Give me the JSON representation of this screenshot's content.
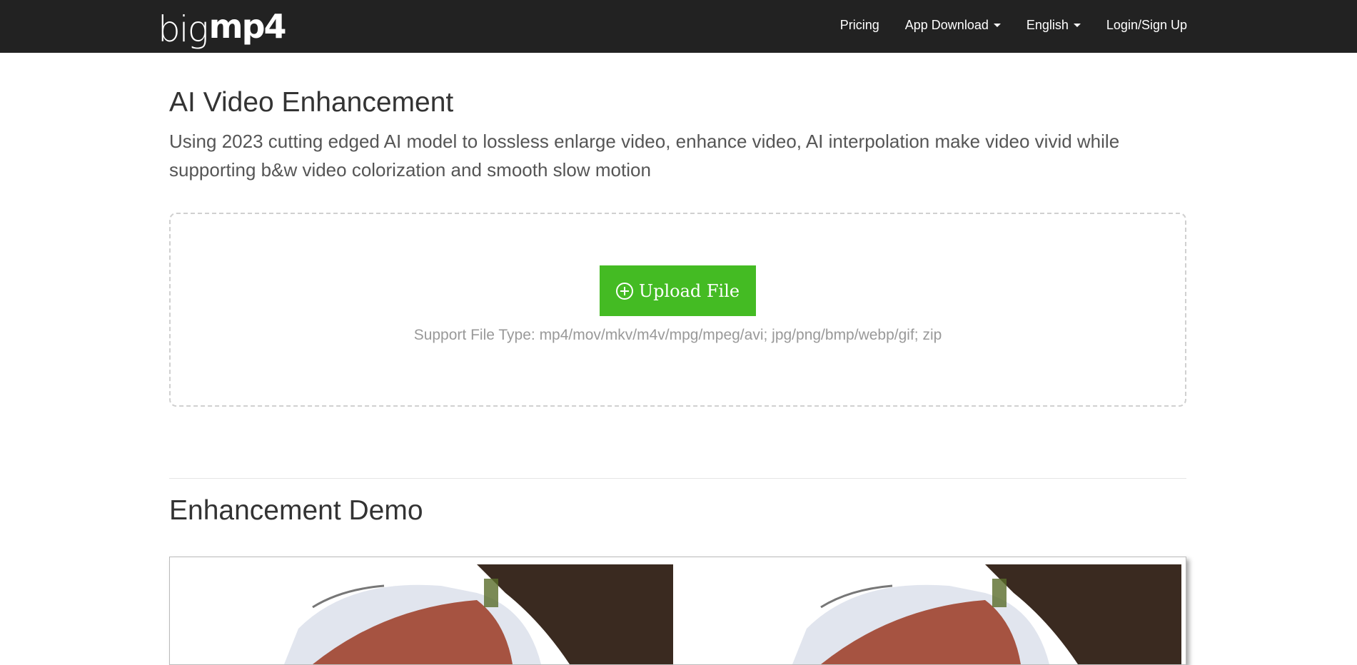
{
  "brand": {
    "logo_light": "big",
    "logo_bold": "mp4"
  },
  "nav": {
    "items": [
      {
        "label": "Pricing",
        "has_dropdown": false
      },
      {
        "label": "App Download",
        "has_dropdown": true
      },
      {
        "label": "English",
        "has_dropdown": true
      },
      {
        "label": "Login/Sign Up",
        "has_dropdown": false
      }
    ]
  },
  "main": {
    "title": "AI Video Enhancement",
    "description": "Using 2023 cutting edged AI model to lossless enlarge video, enhance video, AI interpolation make video vivid while supporting b&w video colorization and smooth slow motion",
    "upload": {
      "button_label": "Upload File",
      "icon": "plus-circle-icon",
      "support_text": "Support File Type: mp4/mov/mkv/m4v/mpg/mpeg/avi; jpg/png/bmp/webp/gif; zip"
    }
  },
  "demo": {
    "title": "Enhancement Demo"
  },
  "colors": {
    "navbar": "#222222",
    "upload_button": "#44bb23",
    "text": "#333333",
    "muted": "#999999"
  }
}
